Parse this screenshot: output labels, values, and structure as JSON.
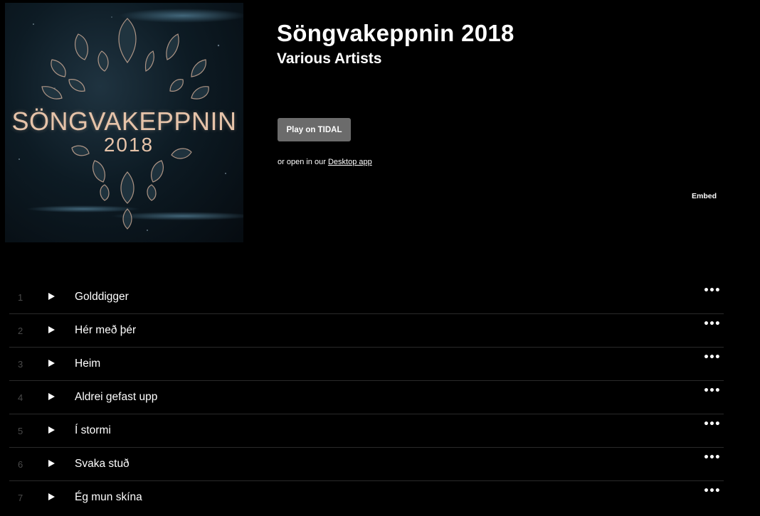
{
  "album": {
    "title": "Söngvakeppnin 2018",
    "artist": "Various Artists",
    "cover": {
      "title_text": "SÖNGVAKEPPNIN",
      "year_text": "2018",
      "accent_color": "#e6c3a9"
    }
  },
  "actions": {
    "play_label": "Play on TIDAL",
    "open_prefix": "or open in our",
    "open_link_label": "Desktop app",
    "embed_label": "Embed",
    "play_button_color": "#6b6b6b"
  },
  "tracks": [
    {
      "number": "1",
      "name": "Golddigger",
      "more_icon": "ellipsis-icon"
    },
    {
      "number": "2",
      "name": "Hér með þér",
      "more_icon": "ellipsis-icon"
    },
    {
      "number": "3",
      "name": "Heim",
      "more_icon": "ellipsis-icon"
    },
    {
      "number": "4",
      "name": "Aldrei gefast upp",
      "more_icon": "ellipsis-icon"
    },
    {
      "number": "5",
      "name": "Í stormi",
      "more_icon": "ellipsis-icon"
    },
    {
      "number": "6",
      "name": "Svaka stuð",
      "more_icon": "ellipsis-icon"
    },
    {
      "number": "7",
      "name": "Ég mun skína",
      "more_icon": "ellipsis-icon"
    }
  ],
  "icons": {
    "track_play": "play-icon",
    "track_more": "ellipsis-icon"
  }
}
